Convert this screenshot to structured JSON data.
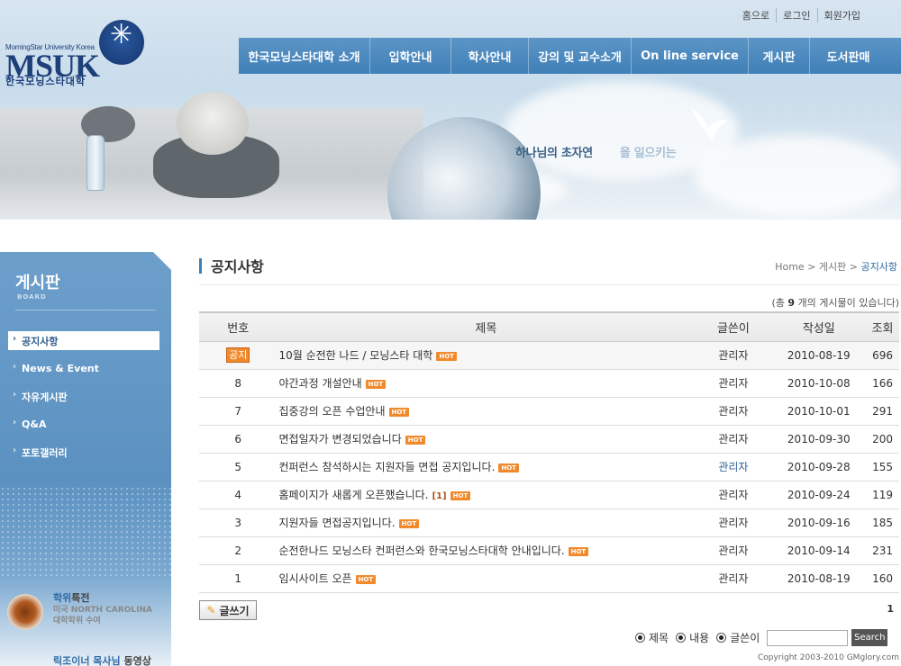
{
  "site": {
    "logo_small": "MorningStar University Korea",
    "logo_main": "MSUK",
    "logo_kr": "한국모닝스타대학"
  },
  "util_links": [
    "홈으로",
    "로그인",
    "회원가입"
  ],
  "gnb": [
    {
      "label": "한국모닝스타대학 소개"
    },
    {
      "label": "입학안내"
    },
    {
      "label": "학사안내"
    },
    {
      "label": "강의 및 교수소개"
    },
    {
      "label": "On line service"
    },
    {
      "label": "게시판"
    },
    {
      "label": "도서판매"
    }
  ],
  "slogan": {
    "main": "하나님의 초자연",
    "fade": "을 일으키는"
  },
  "sidebar": {
    "title": "게시판",
    "subtitle": "BOARD",
    "items": [
      {
        "label": "공지사항",
        "active": true
      },
      {
        "label": "News & Event"
      },
      {
        "label": "자유게시판"
      },
      {
        "label": "Q&A"
      },
      {
        "label": "포토갤러리"
      }
    ],
    "banners": [
      {
        "title_bold": "학위",
        "title_rest": "특전",
        "sub1": "미국 NORTH CAROLINA",
        "sub2": "대학학위 수여"
      },
      {
        "title_bold": "릭조이너 목사님",
        "title_rest": " 동영상",
        "sub1": "",
        "sub2": ""
      }
    ]
  },
  "page": {
    "title": "공지사항",
    "breadcrumb": {
      "home": "Home",
      "sep": " > ",
      "section": "게시판",
      "current": "공지사항"
    },
    "count_prefix": "(총 ",
    "count_value": "9",
    "count_suffix": " 개의 게시물이 있습니다)"
  },
  "table": {
    "headers": {
      "no": "번호",
      "subject": "제목",
      "writer": "글쓴이",
      "date": "작성일",
      "hits": "조회"
    },
    "notice_label": "공지",
    "hot_label": "HOT",
    "rows": [
      {
        "no": "",
        "notice": true,
        "subject": "10월 순전한 나드 / 모닝스타 대학",
        "comments": "",
        "writer": "관리자",
        "date": "2010-08-19",
        "hits": "696"
      },
      {
        "no": "8",
        "subject": "야간과정 개설안내",
        "comments": "",
        "writer": "관리자",
        "date": "2010-10-08",
        "hits": "166"
      },
      {
        "no": "7",
        "subject": "집중강의 오픈 수업안내",
        "comments": "",
        "writer": "관리자",
        "date": "2010-10-01",
        "hits": "291"
      },
      {
        "no": "6",
        "subject": "면접일자가 변경되었습니다",
        "comments": "",
        "writer": "관리자",
        "date": "2010-09-30",
        "hits": "200"
      },
      {
        "no": "5",
        "subject": "컨퍼런스 참석하시는 지원자들 면접 공지입니다.",
        "comments": "",
        "writer": "관리자",
        "date": "2010-09-28",
        "hits": "155"
      },
      {
        "no": "4",
        "subject": "홈페이지가 새롭게 오픈했습니다.",
        "comments": "[1]",
        "writer": "관리자",
        "date": "2010-09-24",
        "hits": "119"
      },
      {
        "no": "3",
        "subject": "지원자들 면접공지입니다.",
        "comments": "",
        "writer": "관리자",
        "date": "2010-09-16",
        "hits": "185"
      },
      {
        "no": "2",
        "subject": "순전한나드 모닝스타 컨퍼런스와 한국모닝스타대학 안내입니다.",
        "comments": "",
        "writer": "관리자",
        "date": "2010-09-14",
        "hits": "231"
      },
      {
        "no": "1",
        "subject": "임시사이트 오픈",
        "comments": "",
        "writer": "관리자",
        "date": "2010-08-19",
        "hits": "160"
      }
    ]
  },
  "write_button": "글쓰기",
  "pagination": {
    "current": "1"
  },
  "search": {
    "options": [
      "제목",
      "내용",
      "글쓴이"
    ],
    "input_value": "",
    "button": "Search"
  },
  "copyright": "Copyright 2003-2010 GMglory.com",
  "colors": {
    "accent": "#3f7fb7",
    "hot": "#f08a2c",
    "sidebar": "#5b91c1"
  }
}
